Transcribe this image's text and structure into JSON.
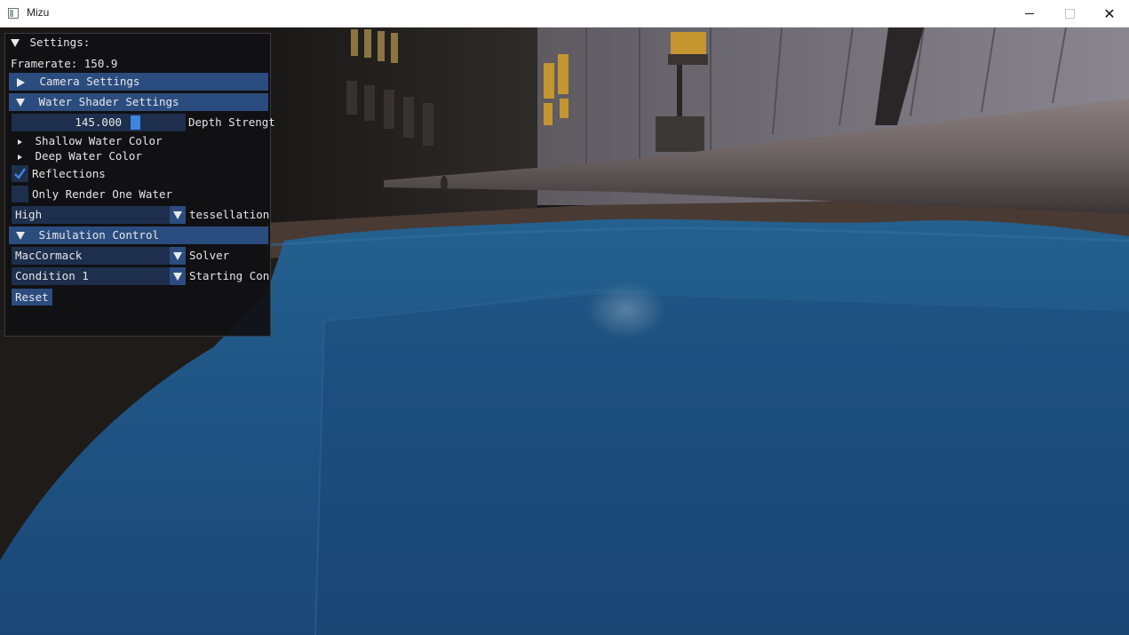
{
  "window": {
    "title": "Mizu",
    "buttons": {
      "minimize": "minimize",
      "maximize": "maximize",
      "close": "close"
    }
  },
  "panel": {
    "title": "Settings:",
    "framerate": "Framerate: 150.9",
    "camera_settings": "Camera Settings",
    "water_shader_settings": "Water Shader Settings",
    "depth_strength": {
      "value": "145.000",
      "label": "Depth Strengt"
    },
    "shallow_water_color": "Shallow Water Color",
    "deep_water_color": "Deep Water Color",
    "reflections": {
      "label": "Reflections",
      "checked": true
    },
    "only_render_one_water": {
      "label": "Only Render One Water",
      "checked": false
    },
    "tessellation": {
      "value": "High",
      "label": "tessellation"
    },
    "simulation_control": "Simulation Control",
    "solver": {
      "value": "MacCormack",
      "label": "Solver"
    },
    "starting_condition": {
      "value": "Condition 1",
      "label": "Starting Conc"
    },
    "reset_button": "Reset"
  },
  "colors": {
    "header": "#2b4c7e",
    "frame_bg": "#1d2f4c",
    "slider_grab": "#3d85e0",
    "water": "#1f4f7c"
  }
}
